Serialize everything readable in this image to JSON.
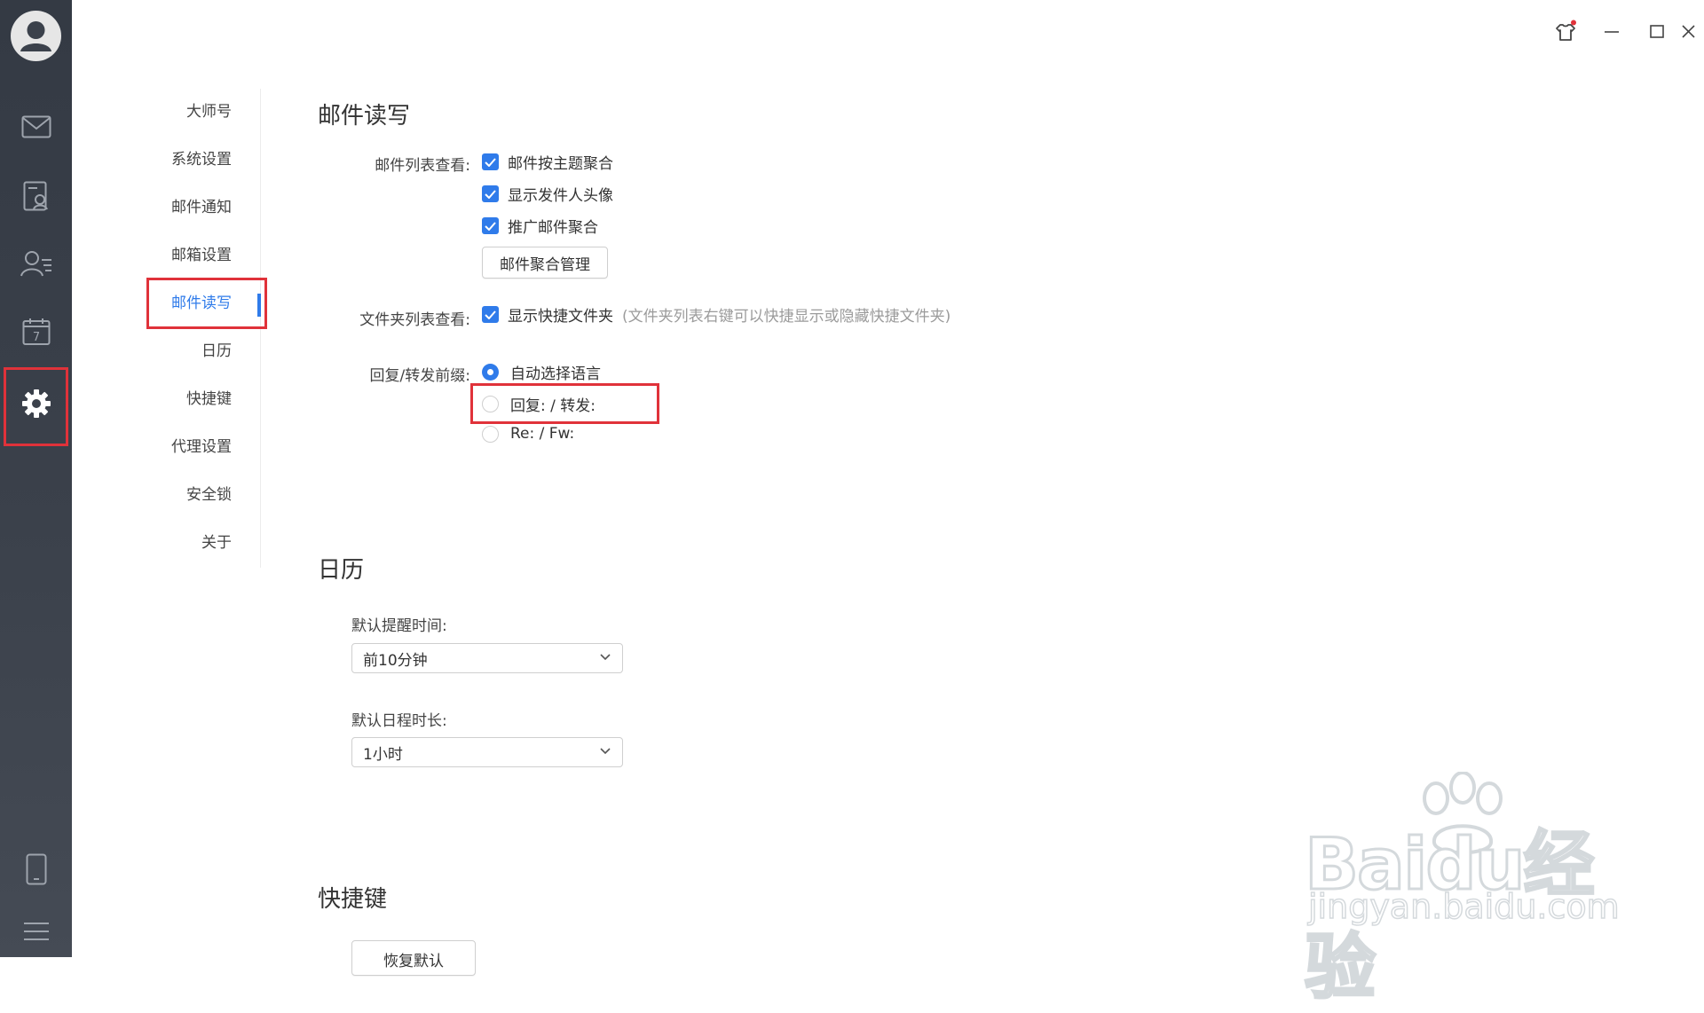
{
  "rail": {
    "icons": [
      "user-avatar",
      "mail-icon",
      "contacts-card-icon",
      "contacts-list-icon",
      "calendar-icon",
      "gear-icon",
      "phone-icon",
      "menu-icon"
    ],
    "calendar_day": "7"
  },
  "window_controls": [
    "skin-icon",
    "minimize-icon",
    "maximize-icon",
    "close-icon"
  ],
  "subnav": {
    "items": [
      {
        "label": "大师号"
      },
      {
        "label": "系统设置"
      },
      {
        "label": "邮件通知"
      },
      {
        "label": "邮箱设置"
      },
      {
        "label": "邮件读写",
        "active": true
      },
      {
        "label": "日历"
      },
      {
        "label": "快捷键"
      },
      {
        "label": "代理设置"
      },
      {
        "label": "安全锁"
      },
      {
        "label": "关于"
      }
    ]
  },
  "mail_rw": {
    "title": "邮件读写",
    "list_view": {
      "label": "邮件列表查看:",
      "options": [
        {
          "label": "邮件按主题聚合",
          "checked": true
        },
        {
          "label": "显示发件人头像",
          "checked": true
        },
        {
          "label": "推广邮件聚合",
          "checked": true
        }
      ],
      "manage_button": "邮件聚合管理"
    },
    "folder_view": {
      "label": "文件夹列表查看:",
      "option": {
        "label": "显示快捷文件夹",
        "checked": true
      },
      "hint": "(文件夹列表右键可以快捷显示或隐藏快捷文件夹)"
    },
    "prefix": {
      "label": "回复/转发前缀:",
      "options": [
        {
          "label": "自动选择语言",
          "selected": true
        },
        {
          "label": "回复: / 转发:",
          "selected": false
        },
        {
          "label": "Re: / Fw:",
          "selected": false
        }
      ]
    }
  },
  "calendar": {
    "title": "日历",
    "reminder_label": "默认提醒时间:",
    "reminder_value": "前10分钟",
    "duration_label": "默认日程时长:",
    "duration_value": "1小时"
  },
  "shortcuts": {
    "title": "快捷键",
    "restore_button": "恢复默认"
  },
  "watermark": {
    "brand": "Baidu经验",
    "url": "jingyan.baidu.com"
  },
  "colors": {
    "accent": "#2f7bea",
    "highlight": "#e0323a",
    "rail": "#3b414b"
  }
}
